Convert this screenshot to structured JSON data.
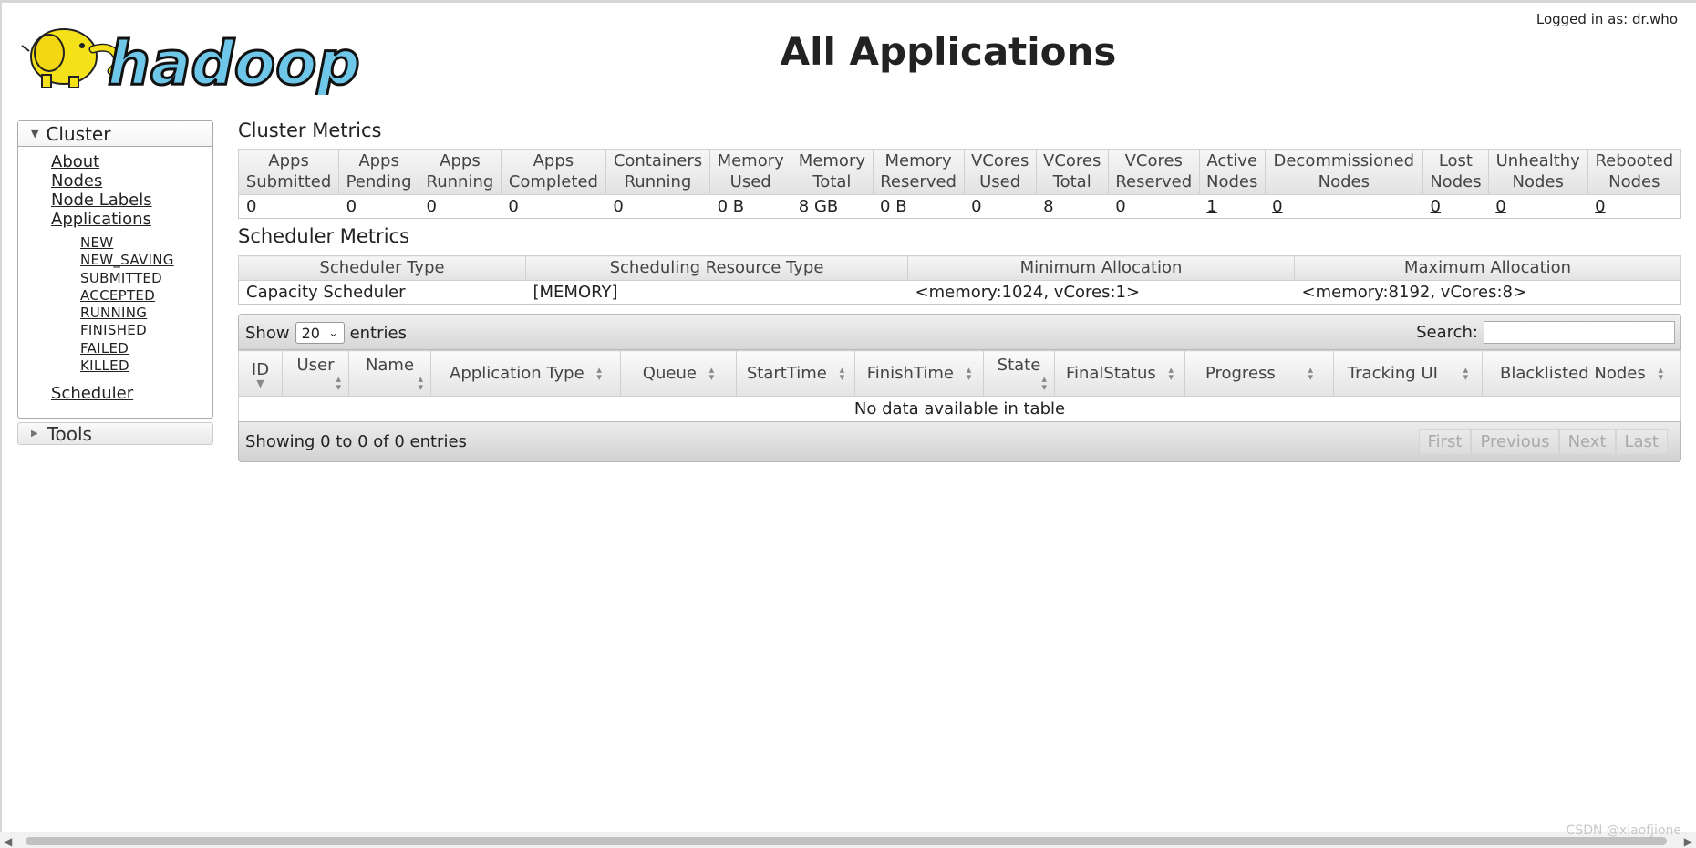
{
  "header": {
    "logo_text": "hadoop",
    "title": "All Applications",
    "logged_in": "Logged in as: dr.who"
  },
  "nav": {
    "cluster_label": "Cluster",
    "items": [
      "About",
      "Nodes",
      "Node Labels",
      "Applications"
    ],
    "app_states": [
      "NEW",
      "NEW_SAVING",
      "SUBMITTED",
      "ACCEPTED",
      "RUNNING",
      "FINISHED",
      "FAILED",
      "KILLED"
    ],
    "scheduler": "Scheduler",
    "tools_label": "Tools"
  },
  "cluster_metrics": {
    "title": "Cluster Metrics",
    "headers": [
      [
        "Apps",
        "Submitted"
      ],
      [
        "Apps",
        "Pending"
      ],
      [
        "Apps",
        "Running"
      ],
      [
        "Apps",
        "Completed"
      ],
      [
        "Containers",
        "Running"
      ],
      [
        "Memory",
        "Used"
      ],
      [
        "Memory",
        "Total"
      ],
      [
        "Memory",
        "Reserved"
      ],
      [
        "VCores",
        "Used"
      ],
      [
        "VCores",
        "Total"
      ],
      [
        "VCores",
        "Reserved"
      ],
      [
        "Active",
        "Nodes"
      ],
      [
        "Decommissioned",
        "Nodes"
      ],
      [
        "Lost",
        "Nodes"
      ],
      [
        "Unhealthy",
        "Nodes"
      ],
      [
        "Rebooted",
        "Nodes"
      ]
    ],
    "values": [
      "0",
      "0",
      "0",
      "0",
      "0",
      "0 B",
      "8 GB",
      "0 B",
      "0",
      "8",
      "0",
      "1",
      "0",
      "0",
      "0",
      "0"
    ]
  },
  "scheduler_metrics": {
    "title": "Scheduler Metrics",
    "headers": [
      "Scheduler Type",
      "Scheduling Resource Type",
      "Minimum Allocation",
      "Maximum Allocation"
    ],
    "values": [
      "Capacity Scheduler",
      "[MEMORY]",
      "<memory:1024, vCores:1>",
      "<memory:8192, vCores:8>"
    ]
  },
  "apps_table": {
    "show_label": "Show",
    "entries_value": "20",
    "entries_label": "entries",
    "search_label": "Search:",
    "columns": [
      "ID",
      "User",
      "Name",
      "Application Type",
      "Queue",
      "StartTime",
      "FinishTime",
      "State",
      "FinalStatus",
      "Progress",
      "Tracking UI",
      "Blacklisted Nodes"
    ],
    "empty_message": "No data available in table",
    "info": "Showing 0 to 0 of 0 entries",
    "pager": [
      "First",
      "Previous",
      "Next",
      "Last"
    ]
  },
  "watermark": "CSDN @xiaofjione",
  "colors": {
    "logo_yellow": "#f5e11a",
    "logo_blue": "#6ec7e8",
    "header_gradient_top": "#f6f6f6",
    "header_gradient_bottom": "#e2e2e2"
  }
}
